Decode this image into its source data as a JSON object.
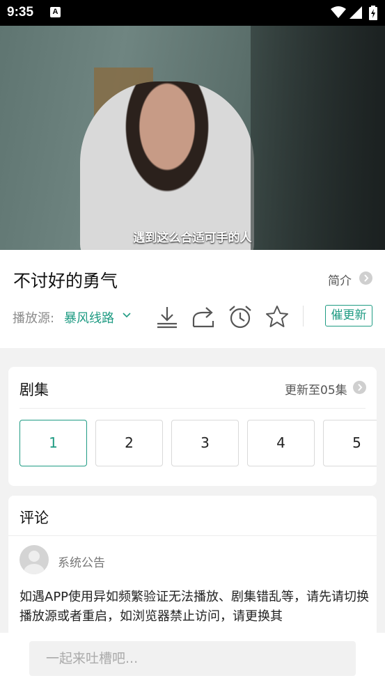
{
  "status_bar": {
    "time": "9:35",
    "notification_badge": "A"
  },
  "video": {
    "subtitle": "遇到这么合适可手的人"
  },
  "info": {
    "title": "不讨好的勇气",
    "intro_label": "简介",
    "source_label": "播放源:",
    "source_value": "暴风线路",
    "urge_label": "催更新",
    "actions": [
      "download-icon",
      "share-icon",
      "alarm-icon",
      "star-icon"
    ]
  },
  "episodes": {
    "heading": "剧集",
    "update_text": "更新至05集",
    "list": [
      "1",
      "2",
      "3",
      "4",
      "5"
    ],
    "active_index": 0
  },
  "comments": {
    "heading": "评论",
    "author": "系统公告",
    "body": "如遇APP使用异如频繁验证无法播放、剧集错乱等，请先请切换播放源或者重启，如浏览器禁止访问，请更换其"
  },
  "comment_input": {
    "placeholder": "一起来吐槽吧..."
  },
  "colors": {
    "accent": "#1f9b83",
    "statusbar": "#000000"
  }
}
